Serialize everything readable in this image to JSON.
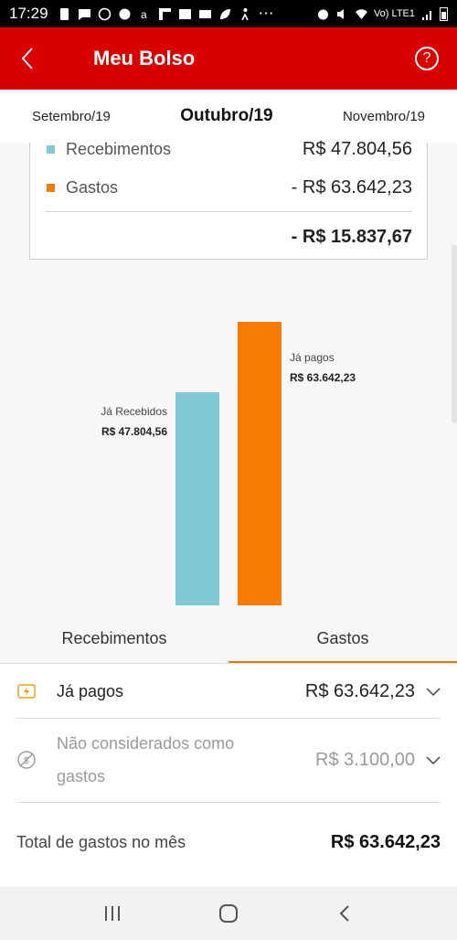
{
  "status_bar": {
    "time": "17:29",
    "network": "Vo) LTE1"
  },
  "header": {
    "title": "Meu Bolso",
    "back_icon": "chevron-left-icon",
    "help_icon": "question-circle-icon",
    "help_symbol": "?"
  },
  "months": {
    "previous": "Setembro/19",
    "current": "Outubro/19",
    "next": "Novembro/19"
  },
  "summary": {
    "receipts_label": "Recebimentos",
    "receipts_value": "R$ 47.804,56",
    "expenses_label": "Gastos",
    "expenses_value": "- R$ 63.642,23",
    "balance_value": "- R$ 15.837,67",
    "receipts_color": "#7fcad6",
    "expenses_color": "#f57c00"
  },
  "chart_data": {
    "type": "bar",
    "categories": [
      "Já Recebidos",
      "Já pagos"
    ],
    "values": [
      47804.56,
      63642.23
    ],
    "value_labels": [
      "R$  47.804,56",
      "R$  63.642,23"
    ],
    "colors": [
      "#7fcad6",
      "#f57c00"
    ]
  },
  "tabs": [
    {
      "label": "Recebimentos",
      "active": false
    },
    {
      "label": "Gastos",
      "active": true
    }
  ],
  "details": {
    "paid": {
      "label": "Já pagos",
      "value": "R$ 63.642,23",
      "icon": "lightning-card-icon"
    },
    "excluded": {
      "label_line1": "Não considerados como",
      "label_line2": "gastos",
      "value": "R$ 3.100,00",
      "icon": "excluded-coin-icon"
    },
    "total": {
      "label": "Total de gastos no mês",
      "value": "R$ 63.642,23"
    }
  },
  "nav": {
    "recent_icon": "recent-apps-icon",
    "home_icon": "home-icon",
    "back_icon": "back-icon"
  }
}
